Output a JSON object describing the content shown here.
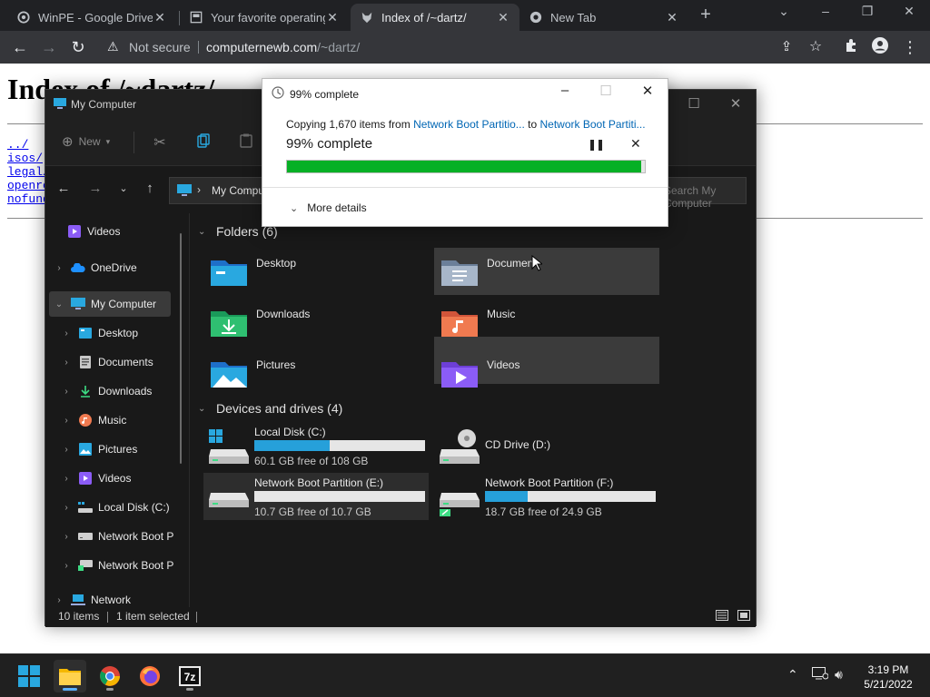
{
  "browser": {
    "tabs": [
      {
        "title": "WinPE - Google Drive",
        "icon": "google-drive-icon"
      },
      {
        "title": "Your favorite operating",
        "icon": "page-icon"
      },
      {
        "title": "Index of /~dartz/",
        "icon": "wolf-icon"
      },
      {
        "title": "New Tab",
        "icon": "chrome-icon"
      }
    ],
    "security_label": "Not secure",
    "url_host": "computernewb.com",
    "url_path": "/~dartz/"
  },
  "page": {
    "heading": "Index of /~dartz/",
    "links": [
      "../",
      "isos/",
      "legal/",
      "openro",
      "nofund"
    ]
  },
  "explorer": {
    "title": "My Computer",
    "new_label": "New",
    "address": "My Computer",
    "search_placeholder": "Search My Computer",
    "nav": [
      {
        "label": "Videos",
        "icon": "videos-icon",
        "chevron": ""
      },
      {
        "label": "OneDrive",
        "icon": "onedrive-icon",
        "chevron": "›"
      },
      {
        "label": "My Computer",
        "icon": "computer-icon",
        "chevron": "⌄"
      },
      {
        "label": "Desktop",
        "icon": "desktop-icon",
        "chevron": "›"
      },
      {
        "label": "Documents",
        "icon": "documents-icon",
        "chevron": "›"
      },
      {
        "label": "Downloads",
        "icon": "downloads-icon",
        "chevron": "›"
      },
      {
        "label": "Music",
        "icon": "music-icon",
        "chevron": "›"
      },
      {
        "label": "Pictures",
        "icon": "pictures-icon",
        "chevron": "›"
      },
      {
        "label": "Videos",
        "icon": "videos-icon",
        "chevron": "›"
      },
      {
        "label": "Local Disk (C:)",
        "icon": "local-disk-icon",
        "chevron": "›"
      },
      {
        "label": "Network Boot P",
        "icon": "drive-icon",
        "chevron": "›"
      },
      {
        "label": "Network Boot P",
        "icon": "network-drive-icon",
        "chevron": "›"
      },
      {
        "label": "Network",
        "icon": "network-icon",
        "chevron": "›"
      }
    ],
    "folders_header": "Folders (6)",
    "folders": [
      {
        "label": "Desktop",
        "icon": "desktop-folder-icon"
      },
      {
        "label": "Documen",
        "icon": "documents-folder-icon"
      },
      {
        "label": "Downloads",
        "icon": "downloads-folder-icon"
      },
      {
        "label": "Music",
        "icon": "music-folder-icon"
      },
      {
        "label": "Pictures",
        "icon": "pictures-folder-icon"
      },
      {
        "label": "Videos",
        "icon": "videos-folder-icon"
      }
    ],
    "drives_header": "Devices and drives (4)",
    "drives": [
      {
        "label": "Local Disk (C:)",
        "free": "60.1 GB free of 108 GB",
        "used_fraction": 0.444,
        "icon": "windows-drive-icon"
      },
      {
        "label": "CD Drive (D:)",
        "free": "",
        "used_fraction": null,
        "icon": "cd-drive-icon"
      },
      {
        "label": "Network Boot Partition (E:)",
        "free": "10.7 GB free of 10.7 GB",
        "used_fraction": 0.0,
        "icon": "drive-icon"
      },
      {
        "label": "Network Boot Partition (F:)",
        "free": "18.7 GB free of 24.9 GB",
        "used_fraction": 0.249,
        "icon": "network-drive-icon"
      }
    ],
    "status_items": "10 items",
    "status_selected": "1 item selected"
  },
  "dialog": {
    "title": "99% complete",
    "copy_prefix": "Copying 1,670 items from",
    "source": "Network Boot Partitio...",
    "to_word": "to",
    "destination": "Network Boot Partiti...",
    "percent_label": "99% complete",
    "progress": 0.99,
    "more_details": "More details"
  },
  "taskbar": {
    "time": "3:19 PM",
    "date": "5/21/2022"
  },
  "colors": {
    "progress_green": "#06b025",
    "drive_bar_blue": "#26a0da",
    "link_blue": "#0066b4"
  }
}
